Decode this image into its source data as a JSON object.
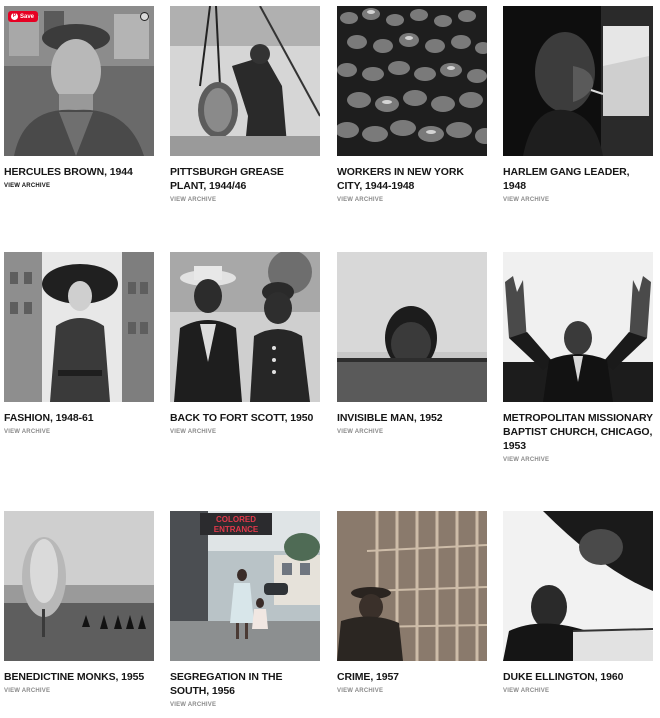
{
  "pin_overlay": {
    "save_label": "Save",
    "pin_glyph": "P"
  },
  "gallery": {
    "view_archive_label": "VIEW ARCHIVE",
    "items": [
      {
        "title": "HERCULES BROWN, 1944"
      },
      {
        "title": "PITTSBURGH GREASE PLANT, 1944/46"
      },
      {
        "title": "WORKERS IN NEW YORK CITY, 1944-1948"
      },
      {
        "title": "HARLEM GANG LEADER, 1948"
      },
      {
        "title": "FASHION, 1948-61"
      },
      {
        "title": "BACK TO FORT SCOTT, 1950"
      },
      {
        "title": "INVISIBLE MAN, 1952"
      },
      {
        "title": "METROPOLITAN MISSIONARY BAPTIST CHURCH, CHICAGO, 1953"
      },
      {
        "title": "BENEDICTINE MONKS, 1955"
      },
      {
        "title": "SEGREGATION IN THE SOUTH, 1956"
      },
      {
        "title": "CRIME, 1957"
      },
      {
        "title": "DUKE ELLINGTON, 1960"
      }
    ],
    "photo_texts": {
      "sign_line_1": "COLORED",
      "sign_line_2": "ENTRANCE"
    }
  },
  "colors": {
    "pinterest_red": "#e60023",
    "title_text": "#161616",
    "archive_text": "#8a8a8a",
    "neon_red": "#e0384a"
  }
}
